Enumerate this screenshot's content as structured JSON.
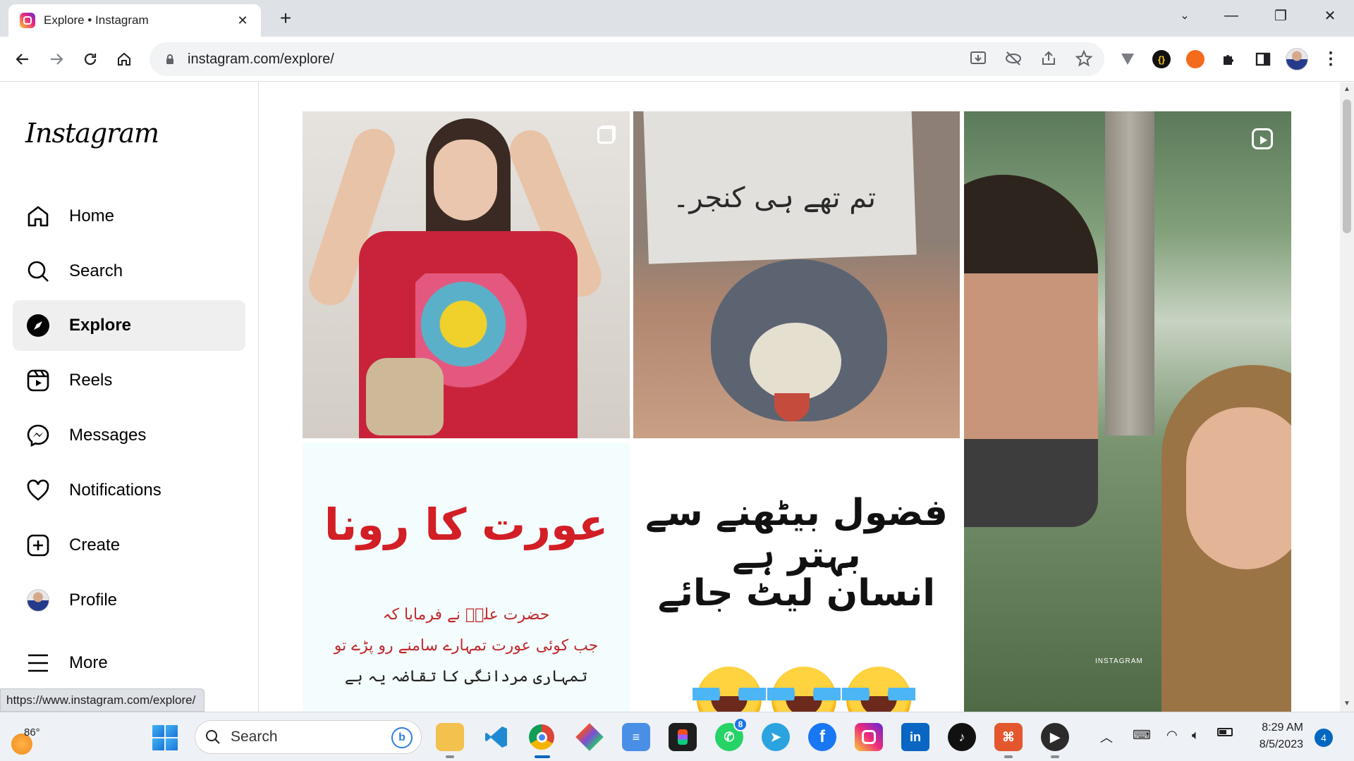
{
  "browser": {
    "tab_title": "Explore • Instagram",
    "url": "instagram.com/explore/",
    "status_url": "https://www.instagram.com/explore/"
  },
  "instagram": {
    "logo": "Instagram",
    "nav": [
      {
        "label": "Home",
        "icon": "home-icon"
      },
      {
        "label": "Search",
        "icon": "search-icon"
      },
      {
        "label": "Explore",
        "icon": "compass-icon",
        "active": true
      },
      {
        "label": "Reels",
        "icon": "reels-icon"
      },
      {
        "label": "Messages",
        "icon": "messenger-icon"
      },
      {
        "label": "Notifications",
        "icon": "heart-icon"
      },
      {
        "label": "Create",
        "icon": "plus-square-icon"
      },
      {
        "label": "Profile",
        "icon": "avatar"
      },
      {
        "label": "More",
        "icon": "menu-icon"
      }
    ],
    "posts": {
      "cartoon_sign_text": "تم تھے ہی کنجر۔",
      "quote_title": "عورت کا رونا",
      "quote_lines": [
        "حضرت علیؓ نے فرمایا کہ",
        "جب کوئی عورت تمہارے سامنے رو پڑے تو",
        "تمہاری مردانگی کا تقاضہ یہ ہے"
      ],
      "meme_lines": [
        "فضول بیٹھنے سے بہتر ہے",
        "انسان لیٹ جائے"
      ],
      "reel_watermark": "INSTAGRAM"
    }
  },
  "taskbar": {
    "temperature": "86°",
    "search_label": "Search",
    "whatsapp_badge": "8",
    "time": "8:29 AM",
    "date": "8/5/2023",
    "notification_count": "4"
  },
  "colors": {
    "accent": "#0067c0",
    "quote_red": "#d21e25"
  }
}
